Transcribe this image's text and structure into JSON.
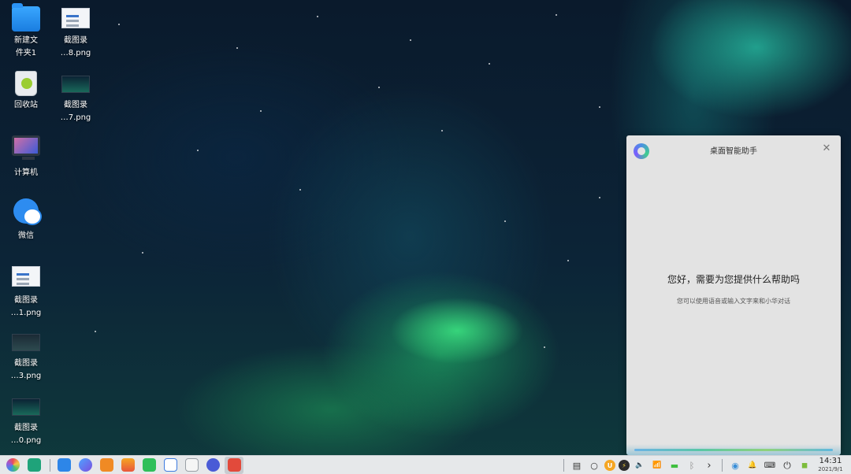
{
  "desktop": {
    "icons": [
      {
        "label": "新建文\n件夹1",
        "icon": "folder-icon"
      },
      {
        "label": "截图录\n…8.png",
        "icon": "image-file-icon"
      },
      {
        "label": "回收站",
        "icon": "trash-icon"
      },
      {
        "label": "截图录\n…7.png",
        "icon": "image-file-icon"
      },
      {
        "label": "计算机",
        "icon": "computer-icon"
      },
      {
        "label": "微信",
        "icon": "wechat-icon"
      },
      {
        "label": "截图录\n…1.png",
        "icon": "image-file-icon"
      },
      {
        "label": "截图录\n…3.png",
        "icon": "image-file-icon"
      },
      {
        "label": "截图录\n…0.png",
        "icon": "image-file-icon"
      }
    ]
  },
  "assistant": {
    "title": "桌面智能助手",
    "close_glyph": "✕",
    "greeting": "您好，需要为您提供什么帮助吗",
    "hint": "您可以使用语音或输入文字来和小华对话"
  },
  "taskbar": {
    "apps": [
      {
        "name": "start-menu-icon",
        "color": "#ffffff"
      },
      {
        "name": "multitask-view-icon",
        "color": "#1fa37a"
      },
      {
        "name": "app-store-icon",
        "color": "#2d86e8"
      },
      {
        "name": "browser-icon",
        "color": "#6f5ae6"
      },
      {
        "name": "file-manager-icon",
        "color": "#f08a24"
      },
      {
        "name": "image-viewer-icon",
        "color": "#e9563c"
      },
      {
        "name": "music-player-icon",
        "color": "#2fbf5a"
      },
      {
        "name": "document-editor-icon",
        "color": "#3d7be0"
      },
      {
        "name": "calendar-icon",
        "color": "#f5f5f5"
      },
      {
        "name": "settings-icon",
        "color": "#4a5bd6"
      },
      {
        "name": "screen-recorder-icon",
        "color": "#e24a3b"
      }
    ],
    "tray": {
      "keyboard": "▤",
      "ime": "○",
      "input_method_u": "U",
      "network": "⚡",
      "volume": "🔈",
      "wifi": "📶",
      "battery": "▬",
      "bluetooth": "ᛒ",
      "expand": "›",
      "assistant": "◉",
      "bell": "🔔",
      "keyboard2": "⌨",
      "power": "⏻",
      "android": "◼"
    },
    "clock": {
      "time": "14:31",
      "date": "2021/9/1"
    }
  }
}
